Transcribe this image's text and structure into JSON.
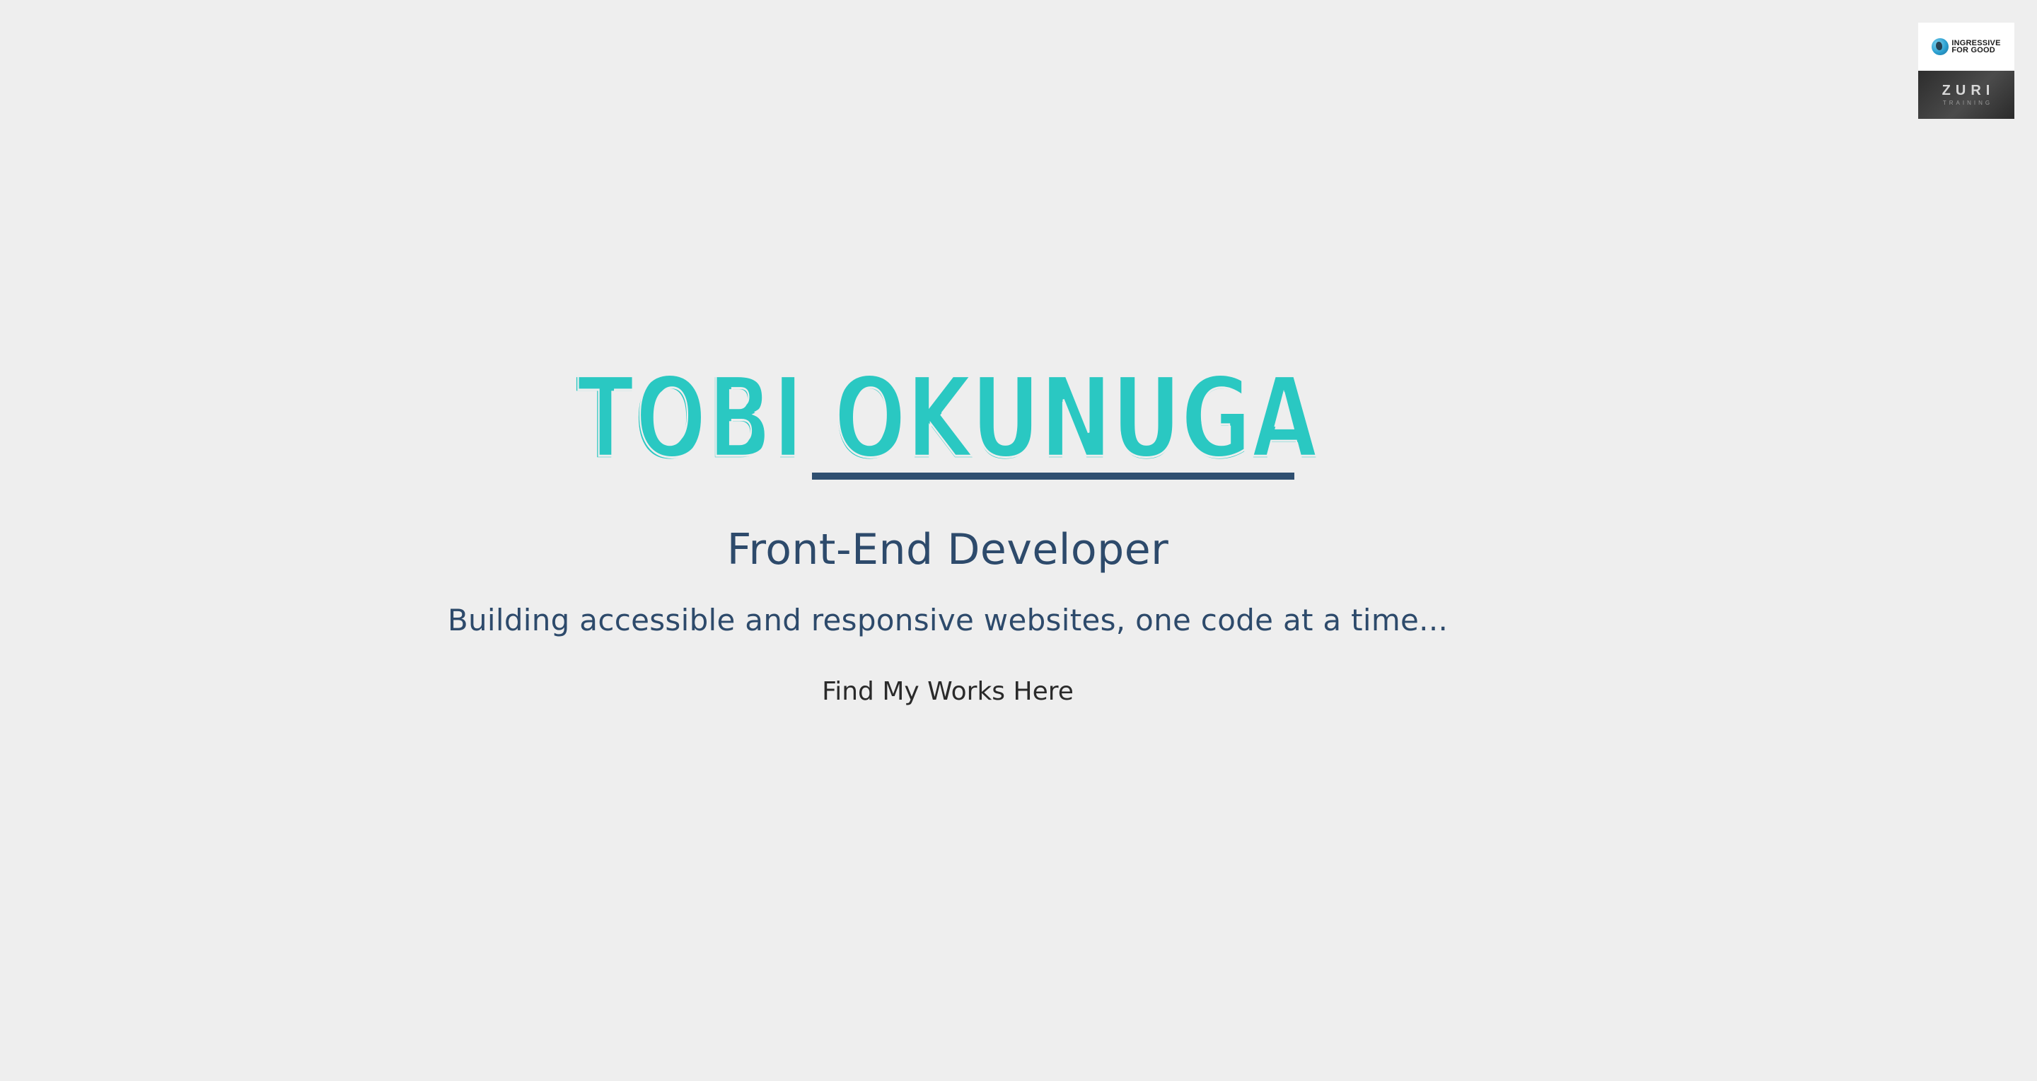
{
  "badge": {
    "top_line1": "INGRESSIVE",
    "top_line2": "FOR GOOD",
    "bottom_word": "ZURI",
    "bottom_sub": "TRAINING"
  },
  "hero": {
    "logo_text": "TOBI OKUNUGA",
    "title": "Front-End Developer",
    "tagline": "Building accessible and responsive websites, one code at a time...",
    "cta_label": "Find My Works Here"
  },
  "colors": {
    "background": "#eeeeee",
    "accent": "#2ac8c2",
    "navy": "#2d4a6b",
    "dark": "#2a2a2a"
  }
}
